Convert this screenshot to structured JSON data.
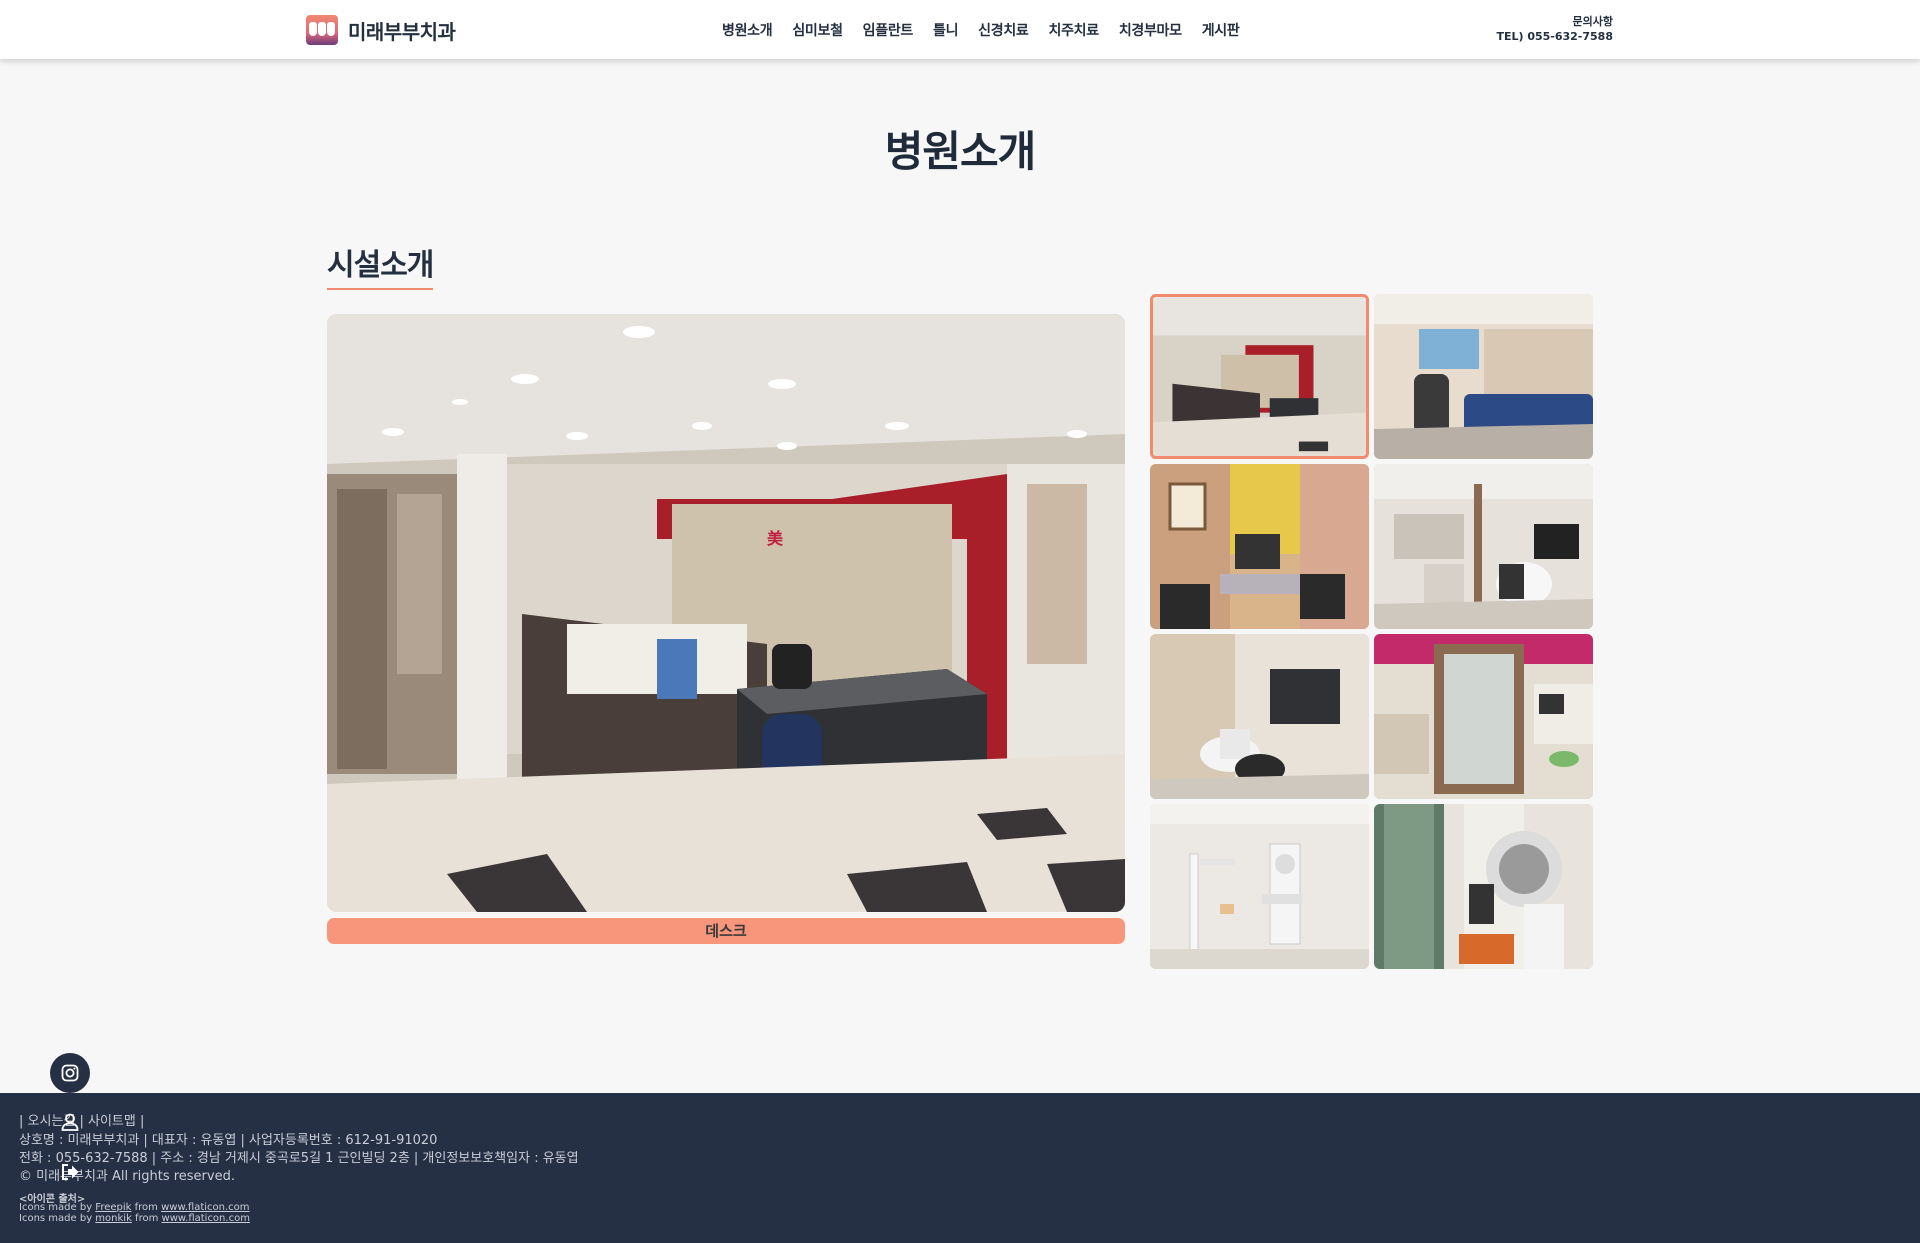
{
  "header": {
    "logo_text": "미래부부치과",
    "nav": [
      "병원소개",
      "심미보철",
      "임플란트",
      "틀니",
      "신경치료",
      "치주치료",
      "치경부마모",
      "게시판"
    ],
    "contact_title": "문의사항",
    "contact_phone": "TEL) 055-632-7588"
  },
  "page": {
    "title": "병원소개",
    "section_title": "시설소개"
  },
  "gallery": {
    "caption": "데스크",
    "thumbnails": 8,
    "active_index": 0
  },
  "footer": {
    "links": [
      "오시는길",
      "사이트맵"
    ],
    "line1": "상호명 : 미래부부치과 | 대표자 : 유동엽 | 사업자등록번호 : 612-91-91020",
    "line2": "전화 : 055-632-7588 | 주소 : 경남 거제시 중곡로5길 1 근인빌딩 2층 | 개인정보보호책임자 : 유동엽",
    "copyright": "© 미래부부치과 All rights reserved.",
    "icons_title": "<아이콘 출처>",
    "credit1": {
      "prefix": "Icons made by",
      "author": "Freepik",
      "from": "from",
      "site": "www.flaticon.com"
    },
    "credit2": {
      "prefix": "Icons made by",
      "author": "monkik",
      "from": "from",
      "site": "www.flaticon.com"
    }
  },
  "colors": {
    "accent": "#f28b6e",
    "footer_bg": "#263044",
    "text_dark": "#243040"
  },
  "icons": [
    "tooth-logo-icon",
    "instagram-icon",
    "user-icon",
    "logout-icon"
  ]
}
